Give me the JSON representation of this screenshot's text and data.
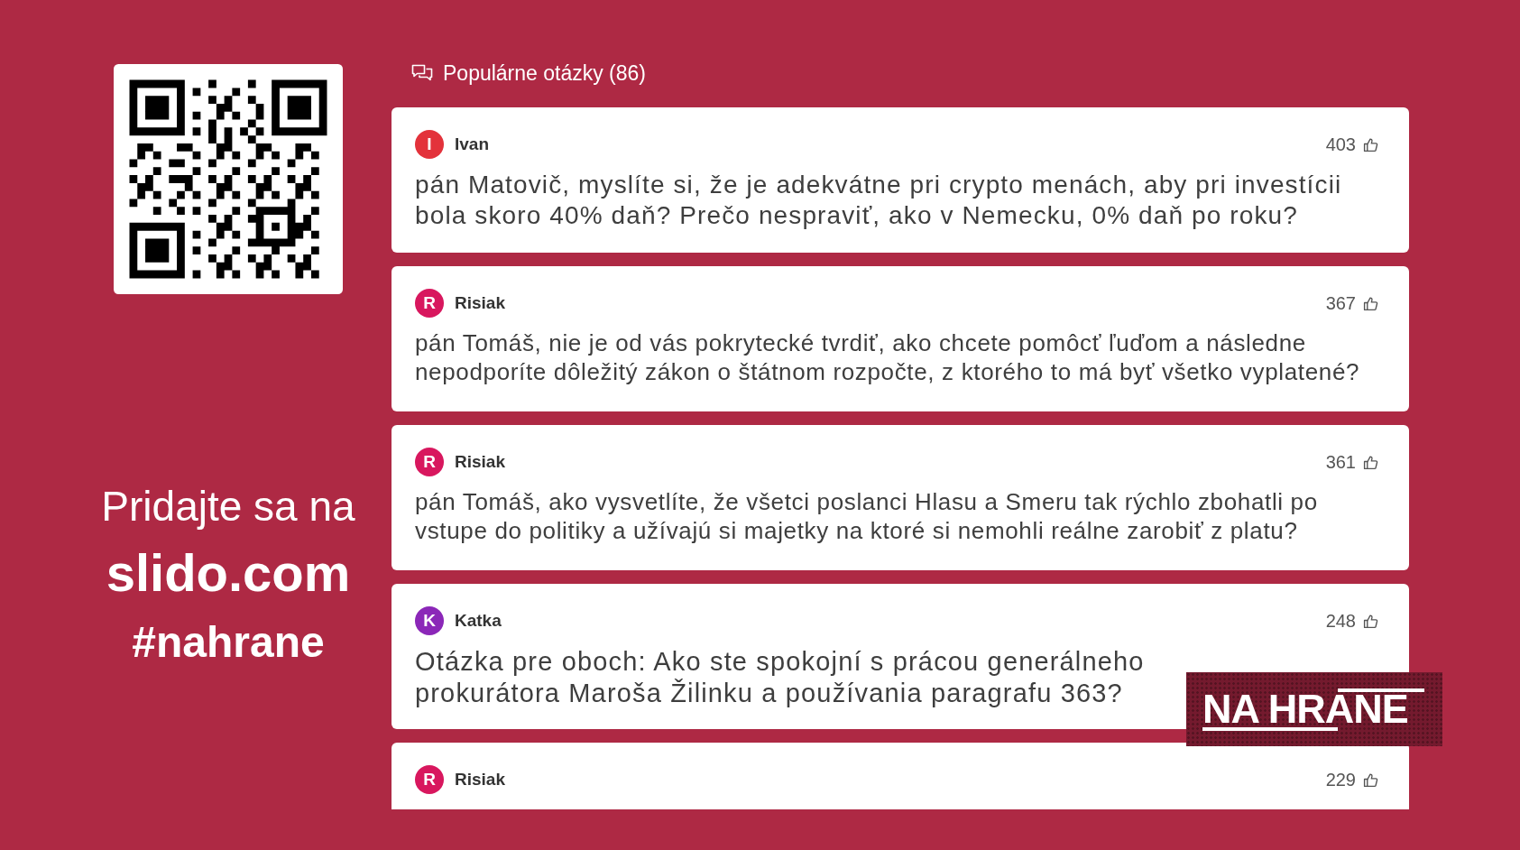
{
  "join_panel": {
    "prompt": "Pridajte sa na",
    "url": "slido.com",
    "hashtag": "#nahrane"
  },
  "questions_panel": {
    "title": "Populárne otázky (86)",
    "questions": [
      {
        "initial": "I",
        "color": "#e3323b",
        "author": "Ivan",
        "votes": "403",
        "text": "pán Matovič, myslíte si, že je adekvátne pri crypto menách, aby pri investícii bola skoro 40% daň? Prečo nespraviť, ako v Nemecku, 0% daň po roku?"
      },
      {
        "initial": "R",
        "color": "#d8175e",
        "author": "Risiak",
        "votes": "367",
        "text": "pán Tomáš, nie je od vás pokrytecké tvrdiť, ako chcete pomôcť ľuďom a následne nepodporíte dôležitý zákon o štátnom rozpočte, z ktorého to má byť všetko vyplatené?"
      },
      {
        "initial": "R",
        "color": "#d8175e",
        "author": "Risiak",
        "votes": "361",
        "text": "pán Tomáš, ako vysvetlíte, že všetci poslanci Hlasu a Smeru tak rýchlo zbohatli po vstupe do politiky a užívajú si majetky na ktoré si nemohli reálne zarobiť z platu?"
      },
      {
        "initial": "K",
        "color": "#8b27b8",
        "author": "Katka",
        "votes": "248",
        "text": "Otázka pre oboch: Ako ste spokojní s prácou generálneho prokurátora Maroša Žilinku a používania paragrafu 363?"
      },
      {
        "initial": "R",
        "color": "#d8175e",
        "author": "Risiak",
        "votes": "229"
      }
    ]
  },
  "overlay_logo": {
    "text": "NA HRANE"
  }
}
